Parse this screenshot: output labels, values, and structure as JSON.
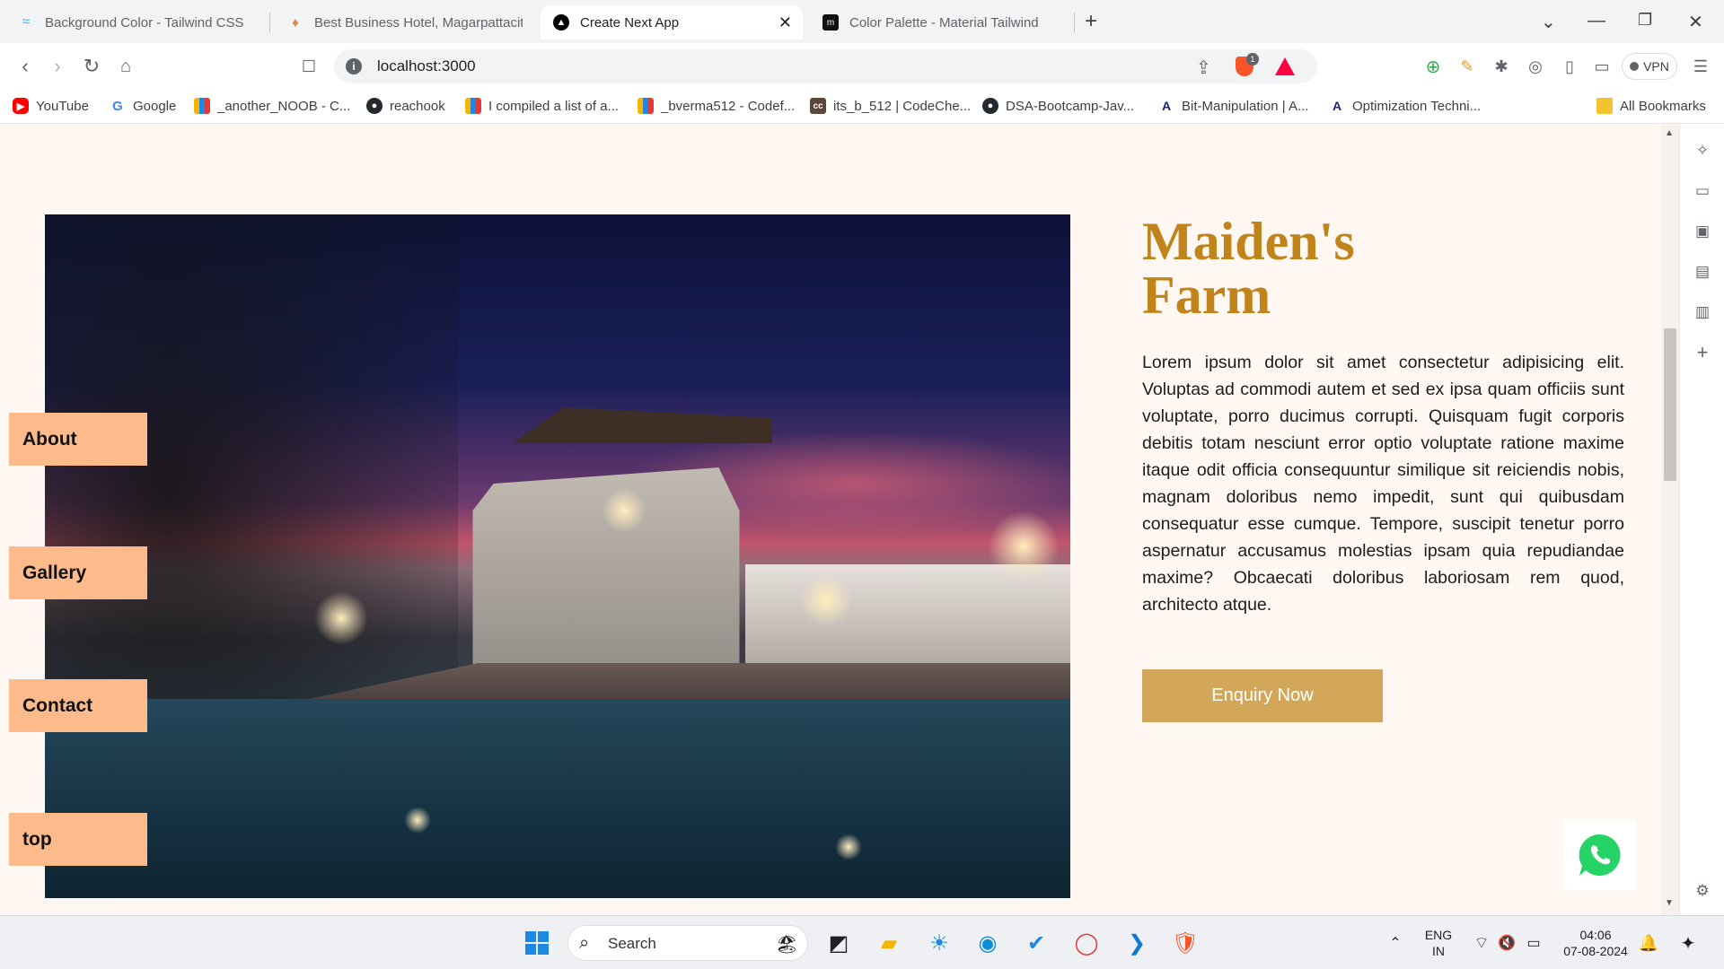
{
  "browser": {
    "tabs": [
      {
        "title": "Background Color - Tailwind CSS",
        "active": false
      },
      {
        "title": "Best Business Hotel, Magarpattacity",
        "active": false
      },
      {
        "title": "Create Next App",
        "active": true
      },
      {
        "title": "Color Palette - Material Tailwind",
        "active": false
      }
    ],
    "close_glyph": "✕",
    "new_tab_glyph": "+",
    "url": "localhost:3000",
    "vpn_label": "VPN",
    "brave_badge_count": "1",
    "bookmarks": [
      {
        "label": "YouTube",
        "icon": "youtube-icon"
      },
      {
        "label": "Google",
        "icon": "google-icon"
      },
      {
        "label": "_another_NOOB - C...",
        "icon": "bar-chart-icon"
      },
      {
        "label": "reachook",
        "icon": "github-icon"
      },
      {
        "label": "I compiled a list of a...",
        "icon": "bar-chart-icon"
      },
      {
        "label": "_bverma512 - Codef...",
        "icon": "bar-chart-icon"
      },
      {
        "label": "its_b_512 | CodeChe...",
        "icon": "codechef-icon"
      },
      {
        "label": "DSA-Bootcamp-Jav...",
        "icon": "github-icon"
      },
      {
        "label": "Bit-Manipulation | A...",
        "icon": "atcoder-icon"
      },
      {
        "label": "Optimization Techni...",
        "icon": "atcoder-icon"
      }
    ],
    "all_bookmarks": "All Bookmarks"
  },
  "page": {
    "side_nav": [
      "About",
      "Gallery",
      "Contact",
      "top"
    ],
    "title": "Maiden's\nFarm",
    "description": "Lorem ipsum dolor sit amet consectetur adipisicing elit. Voluptas ad commodi autem et sed ex ipsa quam officiis sunt voluptate, porro ducimus corrupti. Quisquam fugit corporis debitis totam nesciunt error optio voluptate ratione maxime itaque odit officia consequuntur similique sit reiciendis nobis, magnam doloribus nemo impedit, sunt qui quibusdam consequatur esse cumque. Tempore, suscipit tenetur porro aspernatur accusamus molestias ipsam quia repudiandae maxime? Obcaecati doloribus laboriosam rem quod, architecto atque.",
    "cta_label": "Enquiry Now",
    "hero_image": "resort-pool-at-dusk-image",
    "colors": {
      "background": "#fff7f2",
      "nav_button": "#fdbb8c",
      "title": "#c0841a",
      "cta": "#d3a759",
      "whatsapp": "#25d366"
    }
  },
  "taskbar": {
    "search_label": "Search",
    "language": "ENG",
    "region": "IN",
    "time": "04:06",
    "date": "07-08-2024"
  }
}
